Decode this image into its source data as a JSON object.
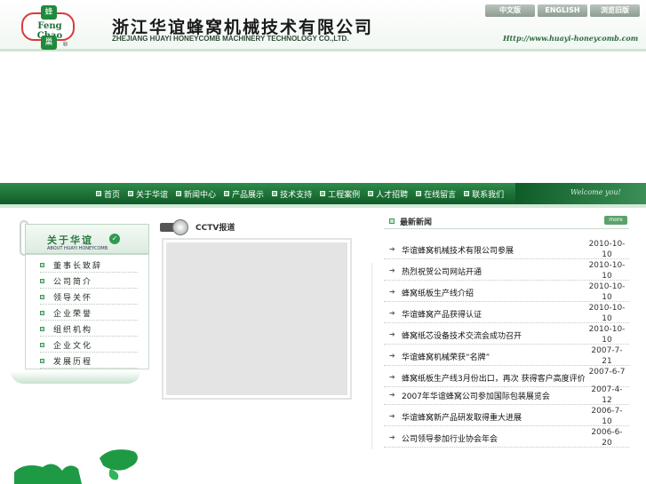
{
  "header": {
    "logo_top": "蜂",
    "logo_word": "Feng Chao",
    "logo_bottom": "巢",
    "logo_reg": "®",
    "company_cn": "浙江华谊蜂窝机械技术有限公司",
    "company_en": "ZHEJIANG HUAYI HONEYCOMB MACHINERY TECHNOLOGY CO.,LTD.",
    "url": "Http://www.huayi-honeycomb.com",
    "languages": [
      "中文版",
      "ENGLISH",
      "浏览旧版"
    ]
  },
  "nav": {
    "items": [
      "首页",
      "关于华谊",
      "新闻中心",
      "产品展示",
      "技术支持",
      "工程案例",
      "人才招聘",
      "在线留言",
      "联系我们"
    ],
    "welcome": "Welcome you!"
  },
  "sidebar": {
    "title": "关于华谊",
    "subtitle": "ABOUT HUAYI HONEYCOMB",
    "items": [
      "董事长致辞",
      "公司简介",
      "领导关怀",
      "企业荣誉",
      "组织机构",
      "企业文化",
      "发展历程"
    ]
  },
  "cctv": {
    "title": "CCTV报道"
  },
  "news": {
    "title": "最新新闻",
    "more": "more",
    "items": [
      {
        "title": "华谊蜂窝机械技术有限公司参展",
        "date": "2010-10-10"
      },
      {
        "title": "热烈祝贺公司网站开通",
        "date": "2010-10-10"
      },
      {
        "title": "蜂窝纸板生产线介绍",
        "date": "2010-10-10"
      },
      {
        "title": "华谊蜂窝产品获得认证",
        "date": "2010-10-10"
      },
      {
        "title": "蜂窝纸芯设备技术交流会成功召开",
        "date": "2010-10-10"
      },
      {
        "title": "华谊蜂窝机械荣获“名牌”",
        "date": "2007-7-21"
      },
      {
        "title": "蜂窝纸板生产线3月份出口，再次 获得客户高度评价",
        "date": "2007-6-7"
      },
      {
        "title": "2007年华谊蜂窝公司参加国际包装展览会",
        "date": "2007-4-12"
      },
      {
        "title": "华谊蜂窝新产品研发取得重大进展",
        "date": "2006-7-10"
      },
      {
        "title": "公司领导参加行业协会年会",
        "date": "2006-6-20"
      }
    ]
  },
  "colors": {
    "nav_green": "#0f5c28",
    "accent_green": "#2f9a4f",
    "logo_red": "#d93a3a"
  }
}
